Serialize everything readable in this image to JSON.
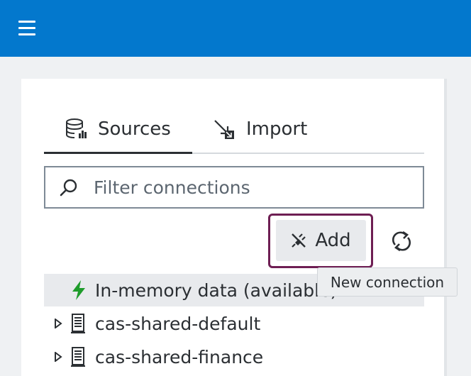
{
  "tabs": [
    {
      "label": "Sources",
      "icon": "database-icon",
      "active": true
    },
    {
      "label": "Import",
      "icon": "import-icon",
      "active": false
    }
  ],
  "filter": {
    "placeholder": "Filter connections",
    "value": ""
  },
  "toolbar": {
    "add_label": "Add",
    "add_tooltip": "New connection",
    "refresh_icon": "refresh-icon"
  },
  "connections": [
    {
      "label": "In-memory data (available)",
      "icon": "lightning-icon",
      "selected": true,
      "expandable": false
    },
    {
      "label": "cas-shared-default",
      "icon": "server-icon",
      "selected": false,
      "expandable": true
    },
    {
      "label": "cas-shared-finance",
      "icon": "server-icon",
      "selected": false,
      "expandable": true
    }
  ],
  "colors": {
    "header": "#0378cd",
    "focus_ring": "#6e1e53",
    "lightning": "#1e9c2b"
  }
}
